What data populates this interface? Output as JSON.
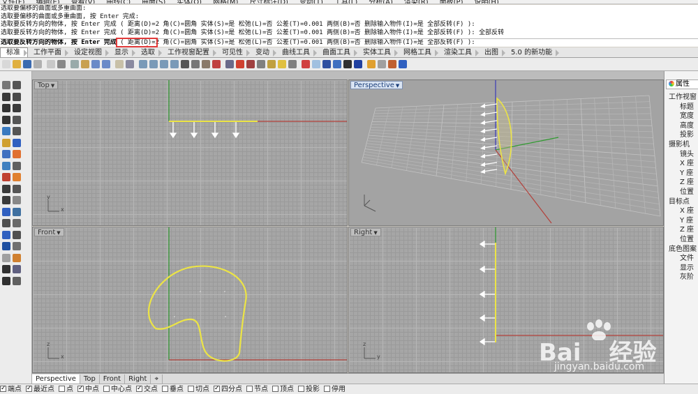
{
  "menu": [
    "文件(F)",
    "编辑(E)",
    "查看(V)",
    "曲线(C)",
    "曲面(S)",
    "实体(O)",
    "网格(M)",
    "尺寸标注(D)",
    "变动(T)",
    "工具(L)",
    "分析(A)",
    "渲染(R)",
    "面板(P)",
    "说明(H)"
  ],
  "command_history": [
    "选取要偏移的曲面或多重曲面:",
    "选取要偏移的曲面或多重曲面, 按 Enter 完成:",
    "选取要反转方向的物体, 按 Enter 完成 ( 距离(D)=2  角(C)=圆角  实体(S)=是  松弛(L)=否  公差(T)=0.001  两侧(B)=否  删除输入物件(I)=是  全部反转(F) ):",
    "选取要反转方向的物体, 按 Enter 完成 ( 距离(D)=2  角(C)=圆角  实体(S)=是  松弛(L)=否  公差(T)=0.001  两侧(B)=否  删除输入物件(I)=是  全部反转(F) ): 全部反转"
  ],
  "command_line": {
    "prompt": "选取要反转方向的物体, 按 Enter 完成",
    "options": "( 距离(D)=2  角(C)=圆角  实体(S)=是  松弛(L)=否  公差(T)=0.001  两侧(B)=否  删除输入物件(I)=是  全部反转(F) ):"
  },
  "tabs": [
    "标准",
    "工作平面",
    "设定视图",
    "显示",
    "选取",
    "工作视窗配置",
    "可见性",
    "变动",
    "曲线工具",
    "曲面工具",
    "实体工具",
    "网格工具",
    "渲染工具",
    "出图",
    "5.0 的新功能"
  ],
  "active_tab": "标准",
  "viewports": {
    "top": {
      "label": "Top"
    },
    "perspective": {
      "label": "Perspective"
    },
    "front": {
      "label": "Front"
    },
    "right": {
      "label": "Right"
    }
  },
  "viewport_tabs": [
    "Perspective",
    "Top",
    "Front",
    "Right",
    "⌖"
  ],
  "active_viewport_tab": "Perspective",
  "osnaps": [
    {
      "label": "端点",
      "checked": true
    },
    {
      "label": "最近点",
      "checked": true
    },
    {
      "label": "点",
      "checked": false
    },
    {
      "label": "中点",
      "checked": true
    },
    {
      "label": "中心点",
      "checked": false
    },
    {
      "label": "交点",
      "checked": true
    },
    {
      "label": "垂点",
      "checked": false
    },
    {
      "label": "切点",
      "checked": false
    },
    {
      "label": "四分点",
      "checked": true
    },
    {
      "label": "节点",
      "checked": false
    },
    {
      "label": "顶点",
      "checked": false
    },
    {
      "label": "投影",
      "checked": false
    },
    {
      "label": "停用",
      "checked": false
    }
  ],
  "properties": {
    "tab_label": "属性",
    "rows": [
      "工作视窗",
      "标题",
      "宽度",
      "高度",
      "投影",
      "摄影机",
      "镜头",
      "X 座",
      "Y 座",
      "Z 座",
      "位置",
      "目标点",
      "X 座",
      "Y 座",
      "Z 座",
      "位置",
      "底色图案",
      "文件",
      "显示",
      "灰阶"
    ]
  },
  "watermark": {
    "brand": "Bai",
    "brand2": "经验",
    "url": "jingyan.baidu.com"
  },
  "axis_labels": {
    "x": "x",
    "y": "y",
    "z": "z"
  },
  "colors": {
    "curve": "#ece445",
    "x_axis": "#b3403a",
    "y_axis": "#2f9a2f",
    "z_axis": "#3a3ab5",
    "annotation": "#e23a3a"
  }
}
